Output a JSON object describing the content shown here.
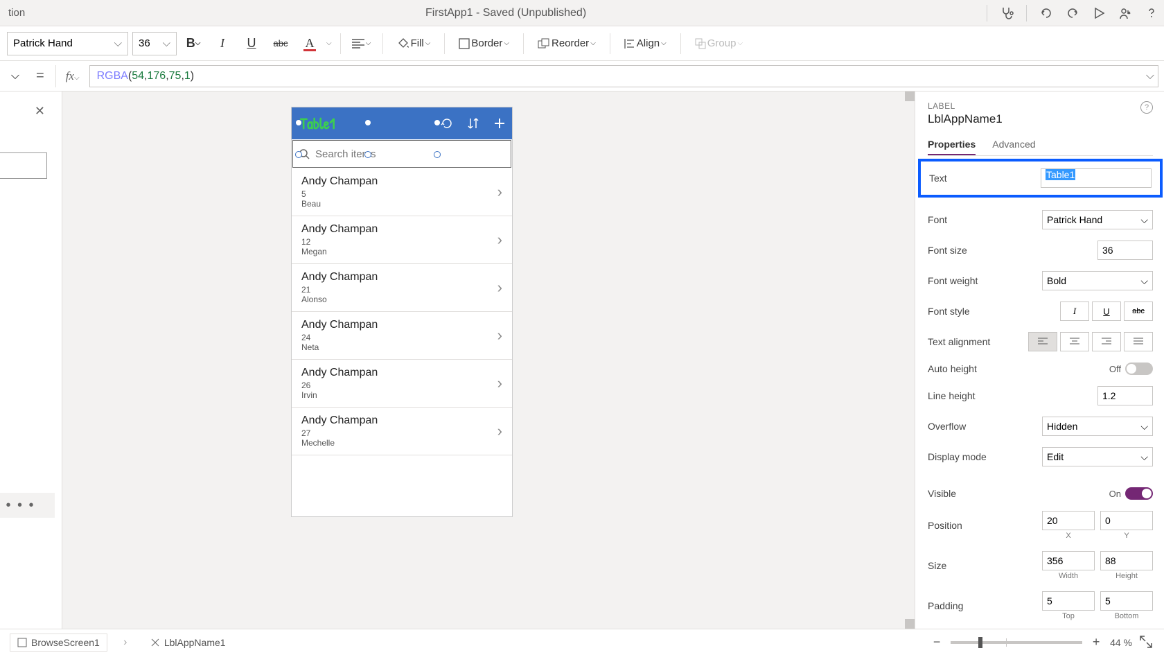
{
  "titlebar": {
    "left_fragment": "tion",
    "center": "FirstApp1 - Saved (Unpublished)"
  },
  "format_toolbar": {
    "font": "Patrick Hand",
    "size": "36",
    "fill_label": "Fill",
    "border_label": "Border",
    "reorder_label": "Reorder",
    "align_label": "Align",
    "group_label": "Group"
  },
  "formula": {
    "fn": "RGBA",
    "args": [
      "54",
      "176",
      "75",
      "1"
    ]
  },
  "phone": {
    "title_text": "Table1",
    "search_placeholder": "Search items",
    "items": [
      {
        "name": "Andy Champan",
        "line2": "5",
        "line3": "Beau"
      },
      {
        "name": "Andy Champan",
        "line2": "12",
        "line3": "Megan"
      },
      {
        "name": "Andy Champan",
        "line2": "21",
        "line3": "Alonso"
      },
      {
        "name": "Andy Champan",
        "line2": "24",
        "line3": "Neta"
      },
      {
        "name": "Andy Champan",
        "line2": "26",
        "line3": "Irvin"
      },
      {
        "name": "Andy Champan",
        "line2": "27",
        "line3": "Mechelle"
      }
    ]
  },
  "properties": {
    "panel_label": "LABEL",
    "control_name": "LblAppName1",
    "tabs": {
      "properties": "Properties",
      "advanced": "Advanced"
    },
    "text_label": "Text",
    "text_value": "Table1",
    "font_label": "Font",
    "font_value": "Patrick Hand",
    "fontsize_label": "Font size",
    "fontsize_value": "36",
    "fontweight_label": "Font weight",
    "fontweight_value": "Bold",
    "fontstyle_label": "Font style",
    "textalign_label": "Text alignment",
    "autoheight_label": "Auto height",
    "autoheight_state": "Off",
    "lineheight_label": "Line height",
    "lineheight_value": "1.2",
    "overflow_label": "Overflow",
    "overflow_value": "Hidden",
    "displaymode_label": "Display mode",
    "displaymode_value": "Edit",
    "visible_label": "Visible",
    "visible_state": "On",
    "position_label": "Position",
    "position_x": "20",
    "position_y": "0",
    "position_x_sub": "X",
    "position_y_sub": "Y",
    "size_label": "Size",
    "size_w": "356",
    "size_h": "88",
    "size_w_sub": "Width",
    "size_h_sub": "Height",
    "padding_label": "Padding",
    "padding_t": "5",
    "padding_b": "5",
    "padding_t_sub": "Top",
    "padding_b_sub": "Bottom"
  },
  "statusbar": {
    "screen_name": "BrowseScreen1",
    "control_name": "LblAppName1",
    "zoom": "44",
    "zoom_unit": "%"
  }
}
